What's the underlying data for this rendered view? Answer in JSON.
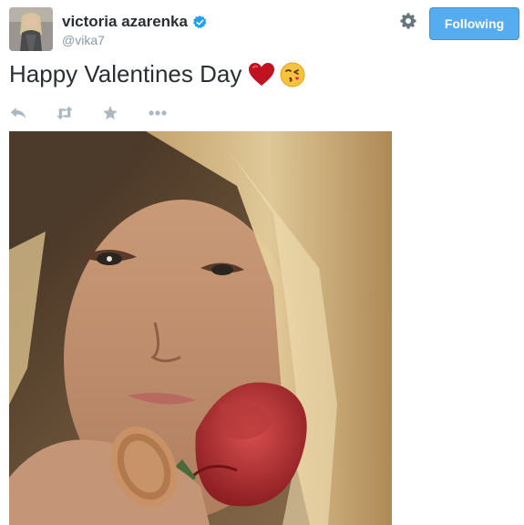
{
  "tweet": {
    "display_name": "victoria azarenka",
    "handle": "@vika7",
    "text": "Happy Valentines Day",
    "emoji": [
      "red-heart",
      "face-throwing-kiss"
    ]
  },
  "header": {
    "follow_label": "Following",
    "settings_icon": "gear-icon"
  },
  "actions": [
    "reply-icon",
    "retweet-icon",
    "favorite-icon",
    "more-icon"
  ],
  "colors": {
    "accent": "#55acee",
    "verified": "#1da1f2",
    "icon_gray": "#aab8c2",
    "heart": "#c1121f"
  }
}
